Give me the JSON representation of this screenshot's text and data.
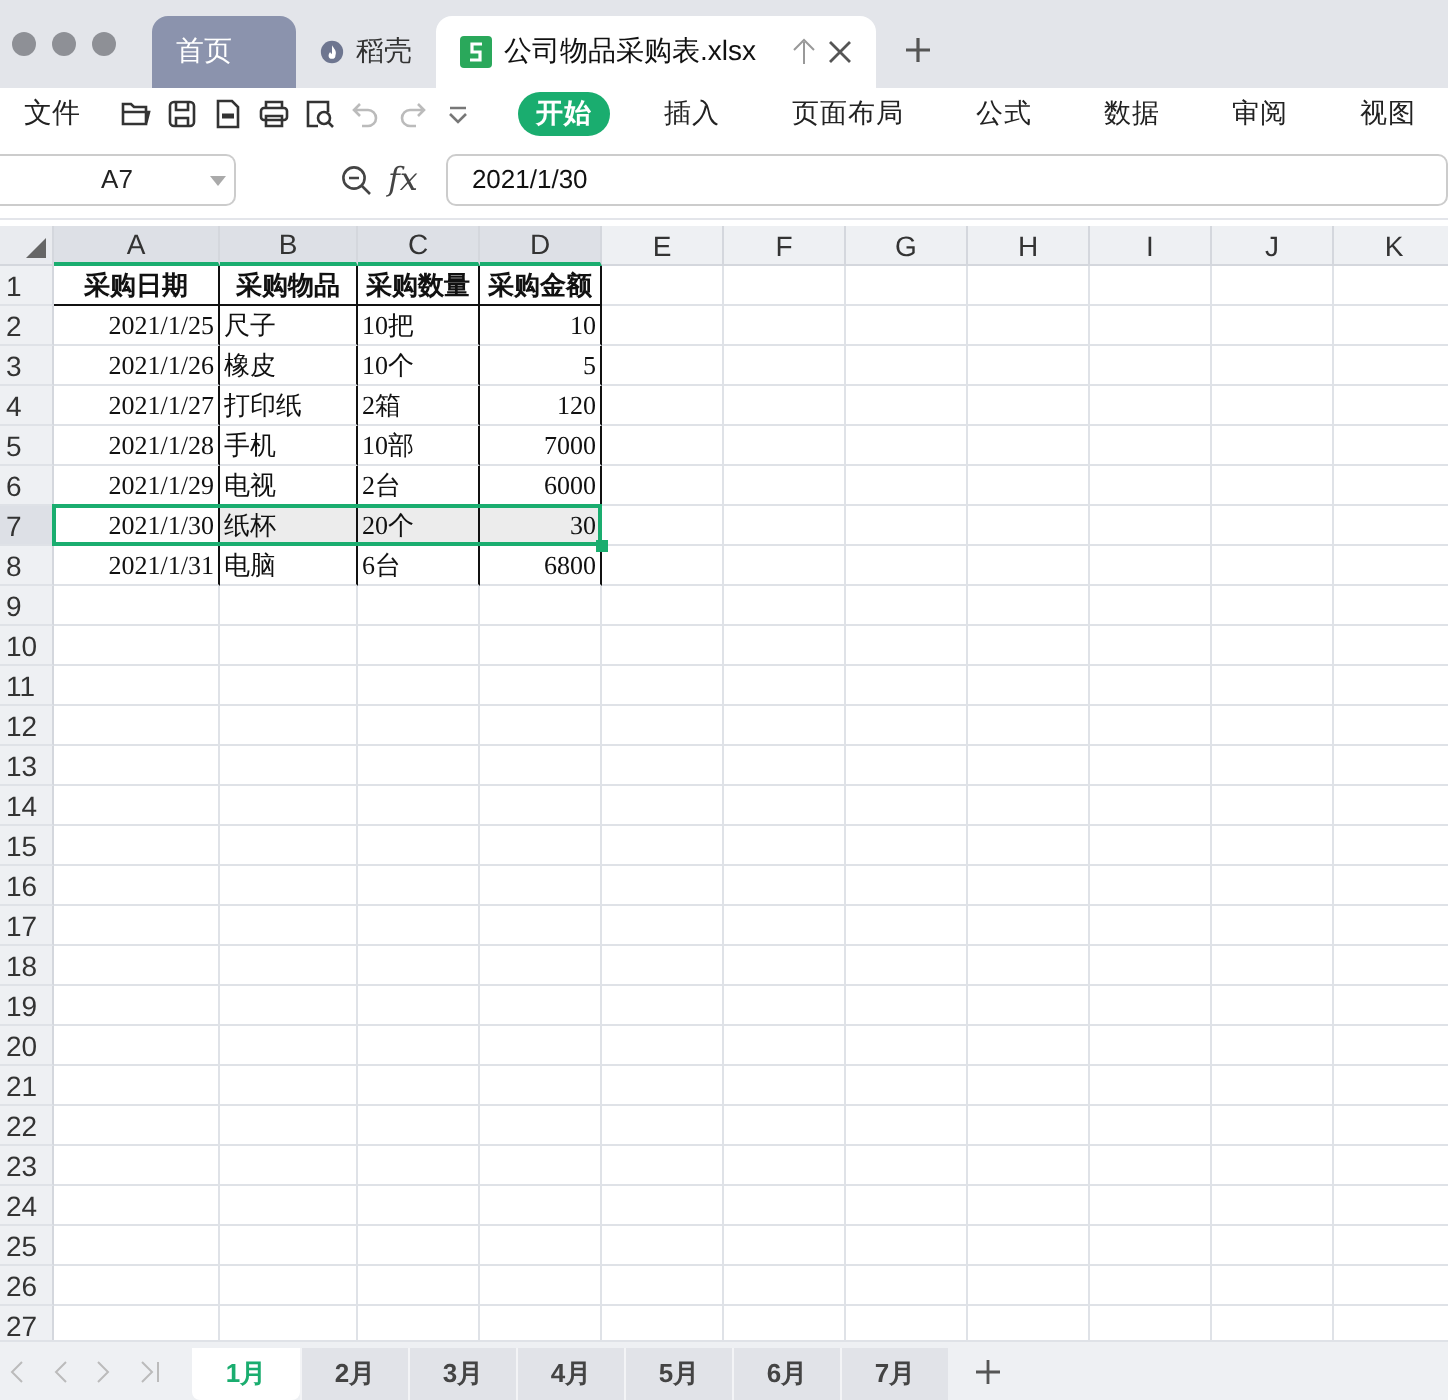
{
  "window_tabs": [
    {
      "label": "首页",
      "kind": "home",
      "selected": false
    },
    {
      "label": "稻壳",
      "kind": "docer",
      "selected": false
    },
    {
      "label": "公司物品采购表.xlsx",
      "kind": "sheet",
      "selected": true
    }
  ],
  "menu": {
    "file_label": "文件"
  },
  "ribbon_tabs": [
    {
      "label": "开始",
      "selected": true
    },
    {
      "label": "插入",
      "selected": false
    },
    {
      "label": "页面布局",
      "selected": false
    },
    {
      "label": "公式",
      "selected": false
    },
    {
      "label": "数据",
      "selected": false
    },
    {
      "label": "审阅",
      "selected": false
    },
    {
      "label": "视图",
      "selected": false
    }
  ],
  "name_box": "A7",
  "formula_label": "fx",
  "formula": "2021/1/30",
  "columns": [
    {
      "label": "A",
      "kind": "date",
      "selected": true
    },
    {
      "label": "B",
      "kind": "text",
      "selected": true
    },
    {
      "label": "C",
      "kind": "text",
      "selected": true
    },
    {
      "label": "D",
      "kind": "number",
      "selected": true
    },
    {
      "label": "E",
      "selected": false
    },
    {
      "label": "F",
      "selected": false
    },
    {
      "label": "G",
      "selected": false
    },
    {
      "label": "H",
      "selected": false
    },
    {
      "label": "I",
      "selected": false
    },
    {
      "label": "J",
      "selected": false
    },
    {
      "label": "K",
      "selected": false
    }
  ],
  "rows": [
    {
      "number": "1",
      "kind": "header",
      "selected": false,
      "cells": [
        "采购日期",
        "采购物品",
        "采购数量",
        "采购金额"
      ]
    },
    {
      "number": "2",
      "kind": "data",
      "selected": false,
      "cells": [
        "2021/1/25",
        "尺子",
        "10把",
        "10"
      ]
    },
    {
      "number": "3",
      "kind": "data",
      "selected": false,
      "cells": [
        "2021/1/26",
        "橡皮",
        "10个",
        "5"
      ]
    },
    {
      "number": "4",
      "kind": "data",
      "selected": false,
      "cells": [
        "2021/1/27",
        "打印纸",
        "2箱",
        "120"
      ]
    },
    {
      "number": "5",
      "kind": "data",
      "selected": false,
      "cells": [
        "2021/1/28",
        "手机",
        "10部",
        "7000"
      ]
    },
    {
      "number": "6",
      "kind": "data",
      "selected": false,
      "cells": [
        "2021/1/29",
        "电视",
        "2台",
        "6000"
      ]
    },
    {
      "number": "7",
      "kind": "data",
      "selected": true,
      "cells": [
        "2021/1/30",
        "纸杯",
        "20个",
        "30"
      ]
    },
    {
      "number": "8",
      "kind": "data",
      "selected": false,
      "cells": [
        "2021/1/31",
        "电脑",
        "6台",
        "6800"
      ]
    },
    {
      "number": "9",
      "selected": false
    },
    {
      "number": "10",
      "selected": false
    },
    {
      "number": "11",
      "selected": false
    },
    {
      "number": "12",
      "selected": false
    },
    {
      "number": "13",
      "selected": false
    },
    {
      "number": "14",
      "selected": false
    },
    {
      "number": "15",
      "selected": false
    },
    {
      "number": "16",
      "selected": false
    },
    {
      "number": "17",
      "selected": false
    },
    {
      "number": "18",
      "selected": false
    },
    {
      "number": "19",
      "selected": false
    },
    {
      "number": "20",
      "selected": false
    },
    {
      "number": "21",
      "selected": false
    },
    {
      "number": "22",
      "selected": false
    },
    {
      "number": "23",
      "selected": false
    },
    {
      "number": "24",
      "selected": false
    },
    {
      "number": "25",
      "selected": false
    },
    {
      "number": "26",
      "selected": false
    },
    {
      "number": "27",
      "selected": false
    }
  ],
  "sheet_tabs": [
    {
      "label": "1月",
      "selected": true
    },
    {
      "label": "2月",
      "selected": false
    },
    {
      "label": "3月",
      "selected": false
    },
    {
      "label": "4月",
      "selected": false
    },
    {
      "label": "5月",
      "selected": false
    },
    {
      "label": "6月",
      "selected": false
    },
    {
      "label": "7月",
      "selected": false
    }
  ]
}
